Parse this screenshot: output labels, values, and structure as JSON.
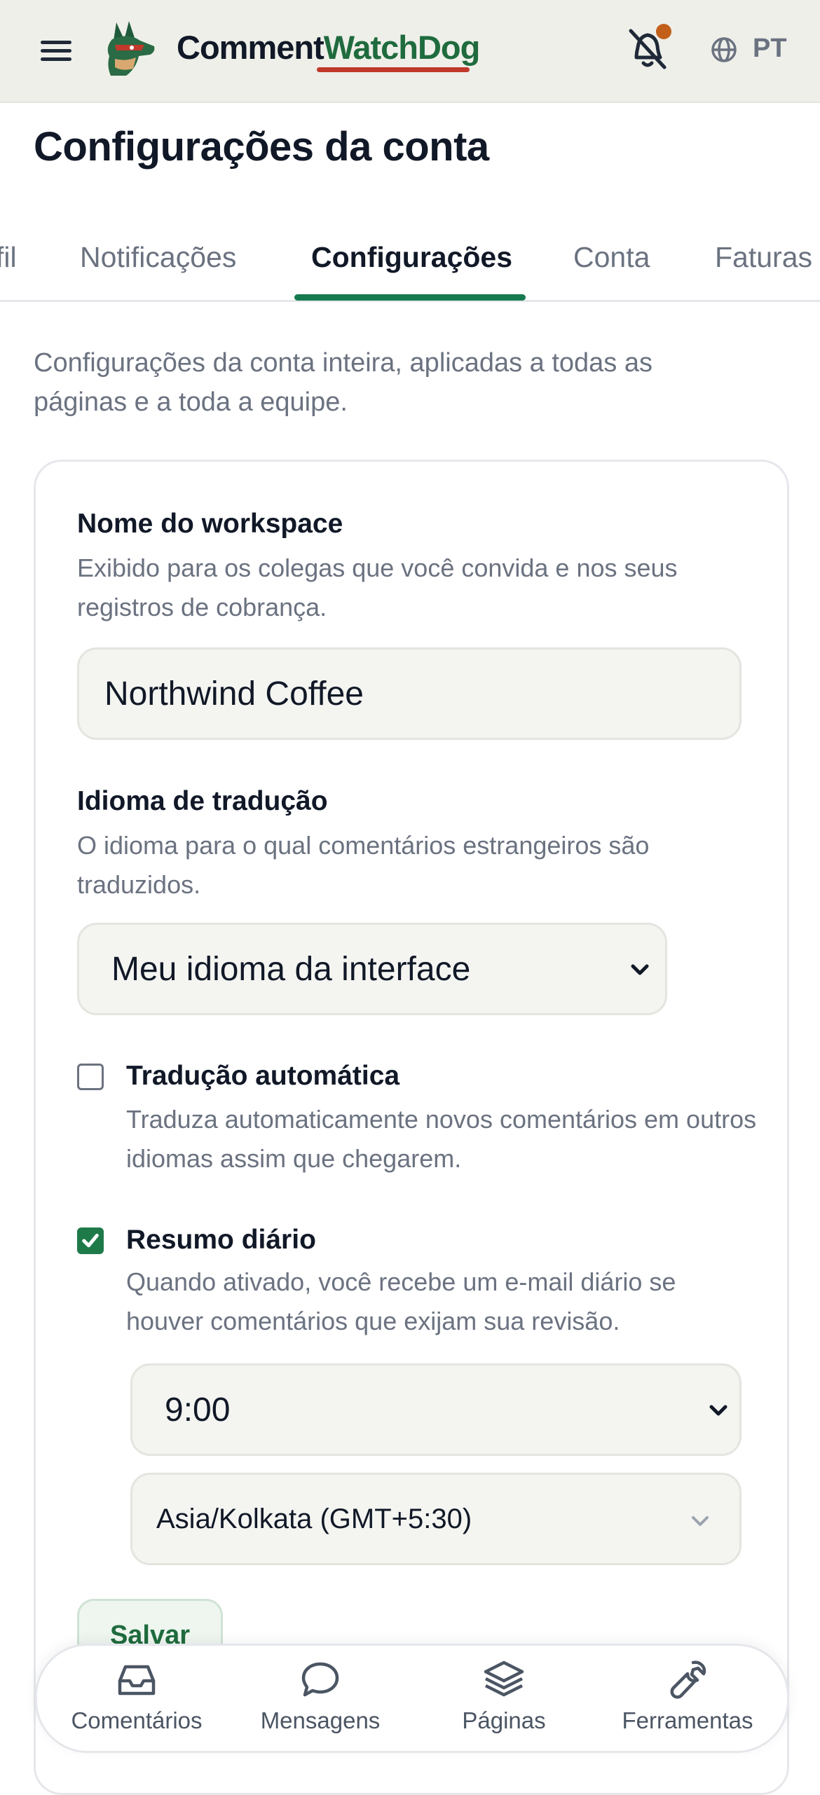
{
  "header": {
    "brand_part1": "Comment",
    "brand_part2": "WatchDog",
    "language": "PT",
    "colors": {
      "background": "#eeefe9",
      "brand_green": "#1f6b3e",
      "underline_red": "#c0392b",
      "notification_dot": "#c2601b"
    }
  },
  "page": {
    "title": "Configurações da conta"
  },
  "tabs": [
    {
      "label": "fil"
    },
    {
      "label": "Notificações"
    },
    {
      "label": "Configurações",
      "active": true
    },
    {
      "label": "Conta"
    },
    {
      "label": "Faturas"
    }
  ],
  "intro": "Configurações da conta inteira, aplicadas a todas as páginas e a toda a equipe.",
  "workspace": {
    "label": "Nome do workspace",
    "help": "Exibido para os colegas que você convida e nos seus registros de cobrança.",
    "value": "Northwind Coffee"
  },
  "translation_language": {
    "label": "Idioma de tradução",
    "help": "O idioma para o qual comentários estrangeiros são traduzidos.",
    "selected": "Meu idioma da interface"
  },
  "auto_translate": {
    "label": "Tradução automática",
    "help": "Traduza automaticamente novos comentários em outros idiomas assim que chegarem.",
    "checked": false
  },
  "daily_summary": {
    "label": "Resumo diário",
    "help": "Quando ativado, você recebe um e-mail diário se houver comentários que exijam sua revisão.",
    "checked": true,
    "time": "9:00",
    "timezone": "Asia/Kolkata (GMT+5:30)"
  },
  "save_label": "Salvar",
  "bottom_nav": [
    {
      "label": "Comentários",
      "icon": "inbox-icon"
    },
    {
      "label": "Mensagens",
      "icon": "chat-bubble-icon"
    },
    {
      "label": "Páginas",
      "icon": "layers-icon"
    },
    {
      "label": "Ferramentas",
      "icon": "wrench-icon"
    }
  ],
  "accent_color": "#157a4f"
}
